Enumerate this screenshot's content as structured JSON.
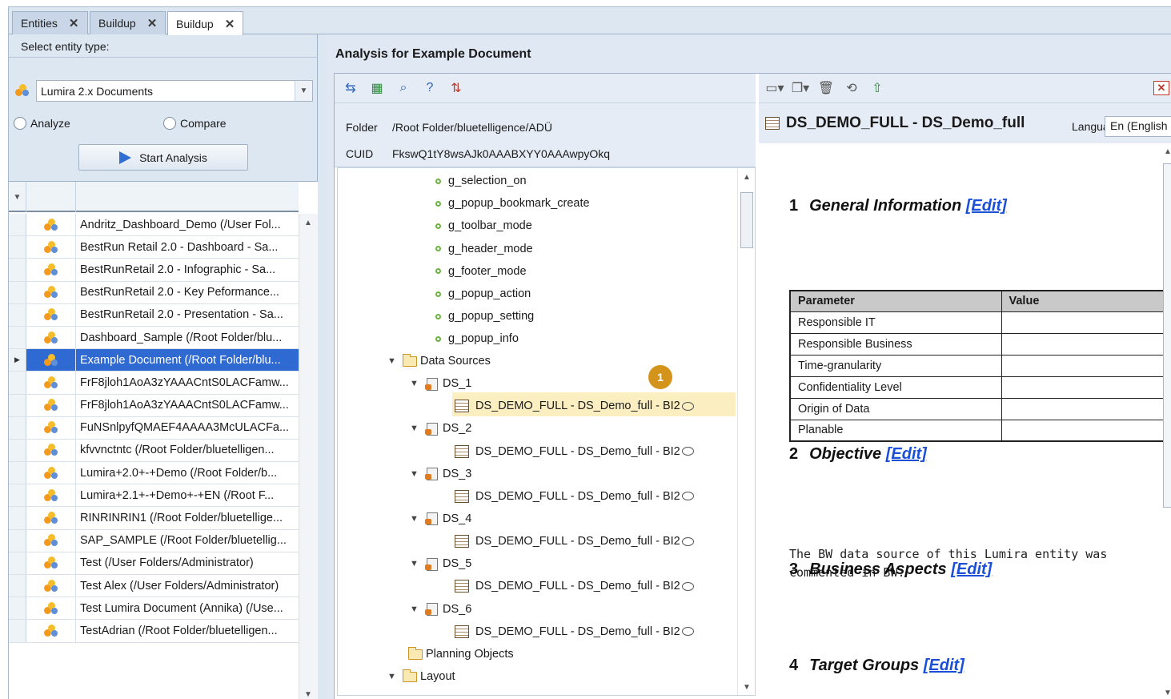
{
  "tabs": [
    {
      "label": "Entities"
    },
    {
      "label": "Buildup"
    },
    {
      "label": "Buildup",
      "active": true
    }
  ],
  "left": {
    "select_label": "Select entity type:",
    "entity_type": "Lumira 2.x Documents",
    "radio_analyze": "Analyze",
    "radio_compare": "Compare",
    "start_button": "Start Analysis",
    "rows": [
      "Andritz_Dashboard_Demo (/User Fol...",
      "BestRun Retail 2.0 - Dashboard - Sa...",
      "BestRunRetail 2.0 - Infographic - Sa...",
      "BestRunRetail 2.0 - Key Peformance...",
      "BestRunRetail 2.0 - Presentation - Sa...",
      "Dashboard_Sample (/Root Folder/blu...",
      "Example Document (/Root Folder/blu...",
      "FrF8jloh1AoA3zYAAACntS0LACFamw...",
      "FrF8jloh1AoA3zYAAACntS0LACFamw...",
      "FuNSnlpyfQMAEF4AAAA3McULACFa...",
      "kfvvnctntc (/Root Folder/bluetelligen...",
      "Lumira+2.0+-+Demo (/Root Folder/b...",
      "Lumira+2.1+-+Demo+-+EN (/Root F...",
      "RINRINRIN1 (/Root Folder/bluetellige...",
      "SAP_SAMPLE (/Root Folder/bluetellig...",
      "Test (/User Folders/Administrator)",
      "Test Alex (/User Folders/Administrator)",
      "Test Lumira Document (Annika) (/Use...",
      "TestAdrian (/Root Folder/bluetelligen..."
    ],
    "selected_index": 6
  },
  "analysis": {
    "title": "Analysis for Example Document",
    "folder_label": "Folder",
    "folder_value": "/Root Folder/bluetelligence/ADÜ",
    "cuid_label": "CUID",
    "cuid_value": "FkswQ1tY8wsAJk0AAABXYY0AAAwpyOkq",
    "badge": "1",
    "tree": {
      "globals": [
        "g_selection_on",
        "g_popup_bookmark_create",
        "g_toolbar_mode",
        "g_header_mode",
        "g_footer_mode",
        "g_popup_action",
        "g_popup_setting",
        "g_popup_info"
      ],
      "data_sources_label": "Data Sources",
      "ds": [
        "DS_1",
        "DS_2",
        "DS_3",
        "DS_4",
        "DS_5",
        "DS_6"
      ],
      "ds_child": "DS_DEMO_FULL - DS_Demo_full - BI2",
      "planning_label": "Planning Objects",
      "layout_label": "Layout"
    }
  },
  "doc": {
    "title": "DS_DEMO_FULL - DS_Demo_full",
    "language_label": "Language",
    "language_value": "En (English",
    "edit_label": "[Edit]",
    "sections": [
      {
        "num": "1",
        "title": "General Information"
      },
      {
        "num": "2",
        "title": "Objective"
      },
      {
        "num": "3",
        "title": "Business Aspects"
      },
      {
        "num": "4",
        "title": "Target Groups"
      }
    ],
    "table_headers": [
      "Parameter",
      "Value"
    ],
    "table_rows": [
      "Responsible IT",
      "Responsible Business",
      "Time-granularity",
      "Confidentiality Level",
      "Origin of Data",
      "Planable"
    ],
    "objective_text": "The BW data source of this Lumira entity was commented in BW."
  }
}
